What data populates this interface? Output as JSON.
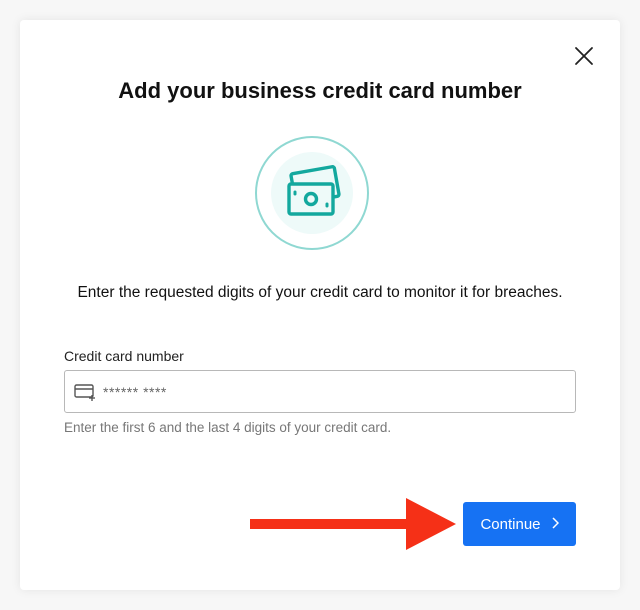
{
  "modal": {
    "title": "Add your business credit card number",
    "description": "Enter the requested digits of your credit card to monitor it for breaches.",
    "close_icon": "close-icon",
    "illustration_icon": "money-bills-icon"
  },
  "form": {
    "card_label": "Credit card number",
    "card_placeholder": "****** ****",
    "card_value": "",
    "card_icon": "credit-card-add-icon",
    "helper_text": "Enter the first 6 and the last 4 digits of your credit card."
  },
  "actions": {
    "continue_label": "Continue",
    "continue_icon": "chevron-right-icon"
  },
  "colors": {
    "accent": "#1672f3",
    "teal": "#13a89e",
    "annotation_arrow": "#f53017"
  }
}
